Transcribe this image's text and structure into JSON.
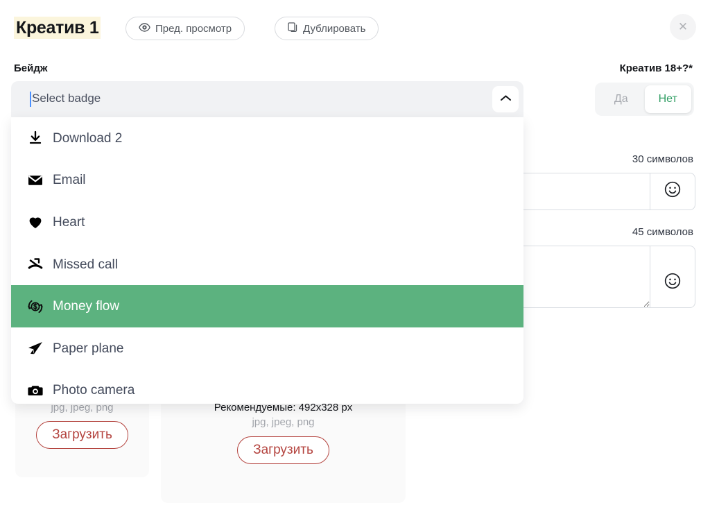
{
  "header": {
    "title": "Креатив 1",
    "preview_label": "Пред. просмотр",
    "duplicate_label": "Дублировать",
    "close_label": "✕",
    "preview_icon": "eye-icon",
    "duplicate_icon": "copy-icon",
    "title_highlight": "#fbf5dc"
  },
  "badge_field": {
    "label": "Бейдж",
    "placeholder": "Select badge",
    "value": "",
    "caret_icon": "chevron-up-icon",
    "expanded": true
  },
  "dropdown": {
    "items": [
      {
        "label": "Download 2",
        "icon": "download-icon",
        "selected": false
      },
      {
        "label": "Email",
        "icon": "envelope-icon",
        "selected": false
      },
      {
        "label": "Heart",
        "icon": "heart-icon",
        "selected": false
      },
      {
        "label": "Missed call",
        "icon": "missed-call-icon",
        "selected": false
      },
      {
        "label": "Money flow",
        "icon": "money-flow-icon",
        "selected": true
      },
      {
        "label": "Paper plane",
        "icon": "paper-plane-icon",
        "selected": false
      },
      {
        "label": "Photo camera",
        "icon": "photo-camera-icon",
        "selected": false
      }
    ],
    "highlight_color": "#5cb27f"
  },
  "age_toggle": {
    "label": "Креатив 18+?*",
    "yes_label": "Да",
    "no_label": "Нет",
    "selected": "Нет",
    "active_color": "#2f9e63"
  },
  "text_fields": [
    {
      "counter": "30 символов",
      "value": "",
      "emoji_icon": "smiley-icon"
    },
    {
      "counter": "45 символов",
      "value": "",
      "emoji_icon": "smiley-icon"
    }
  ],
  "upload_cards": [
    {
      "recommended": "",
      "formats": "jpg, jpeg, png",
      "button_label": "Загрузить"
    },
    {
      "recommended": "Рекомендуемые: 492x328 px",
      "formats": "jpg, jpeg, png",
      "button_label": "Загрузить"
    }
  ],
  "colors": {
    "upload_button": "#b4443f",
    "highlight_green": "#5cb27f"
  }
}
